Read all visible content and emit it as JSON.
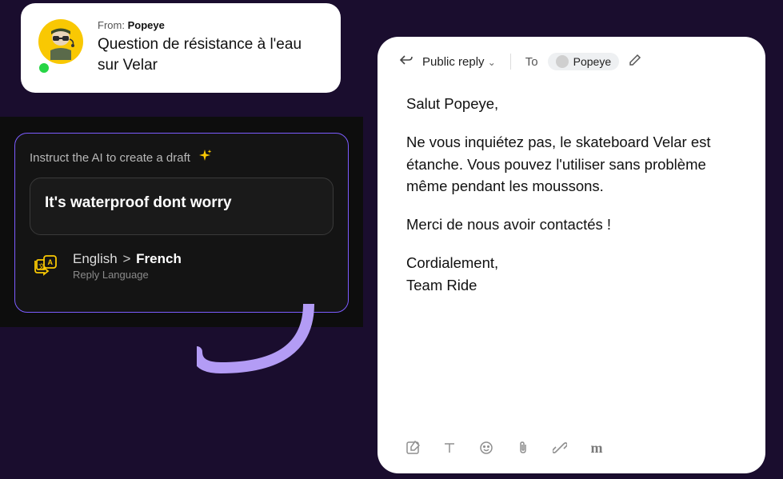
{
  "message": {
    "from_prefix": "From:",
    "from_name": "Popeye",
    "subject": "Question de résistance à l'eau sur Velar"
  },
  "ai_panel": {
    "instruct_label": "Instruct the AI to create a draft",
    "prompt_text": "It's waterproof dont worry",
    "lang_source": "English",
    "lang_arrow": ">",
    "lang_target": "French",
    "lang_sub": "Reply Language"
  },
  "reply": {
    "type_label": "Public reply",
    "to_label": "To",
    "recipient": "Popeye",
    "greeting": "Salut Popeye,",
    "body_p1": "Ne vous inquiétez pas, le skateboard Velar est étanche. Vous pouvez l'utiliser sans problème même pendant les moussons.",
    "body_p2": "Merci de nous avoir contactés !",
    "closing": "Cordialement,",
    "signature": "Team Ride"
  },
  "icons": {
    "sparkle": "sparkle-icon",
    "translate": "translate-icon",
    "reply_arrow": "reply-arrow-icon",
    "chevron_down": "chevron-down-icon",
    "edit": "edit-icon",
    "compose": "compose-icon",
    "text_format": "text-format-icon",
    "emoji": "emoji-icon",
    "attachment": "attachment-icon",
    "link": "link-icon",
    "macro": "macro-icon"
  }
}
